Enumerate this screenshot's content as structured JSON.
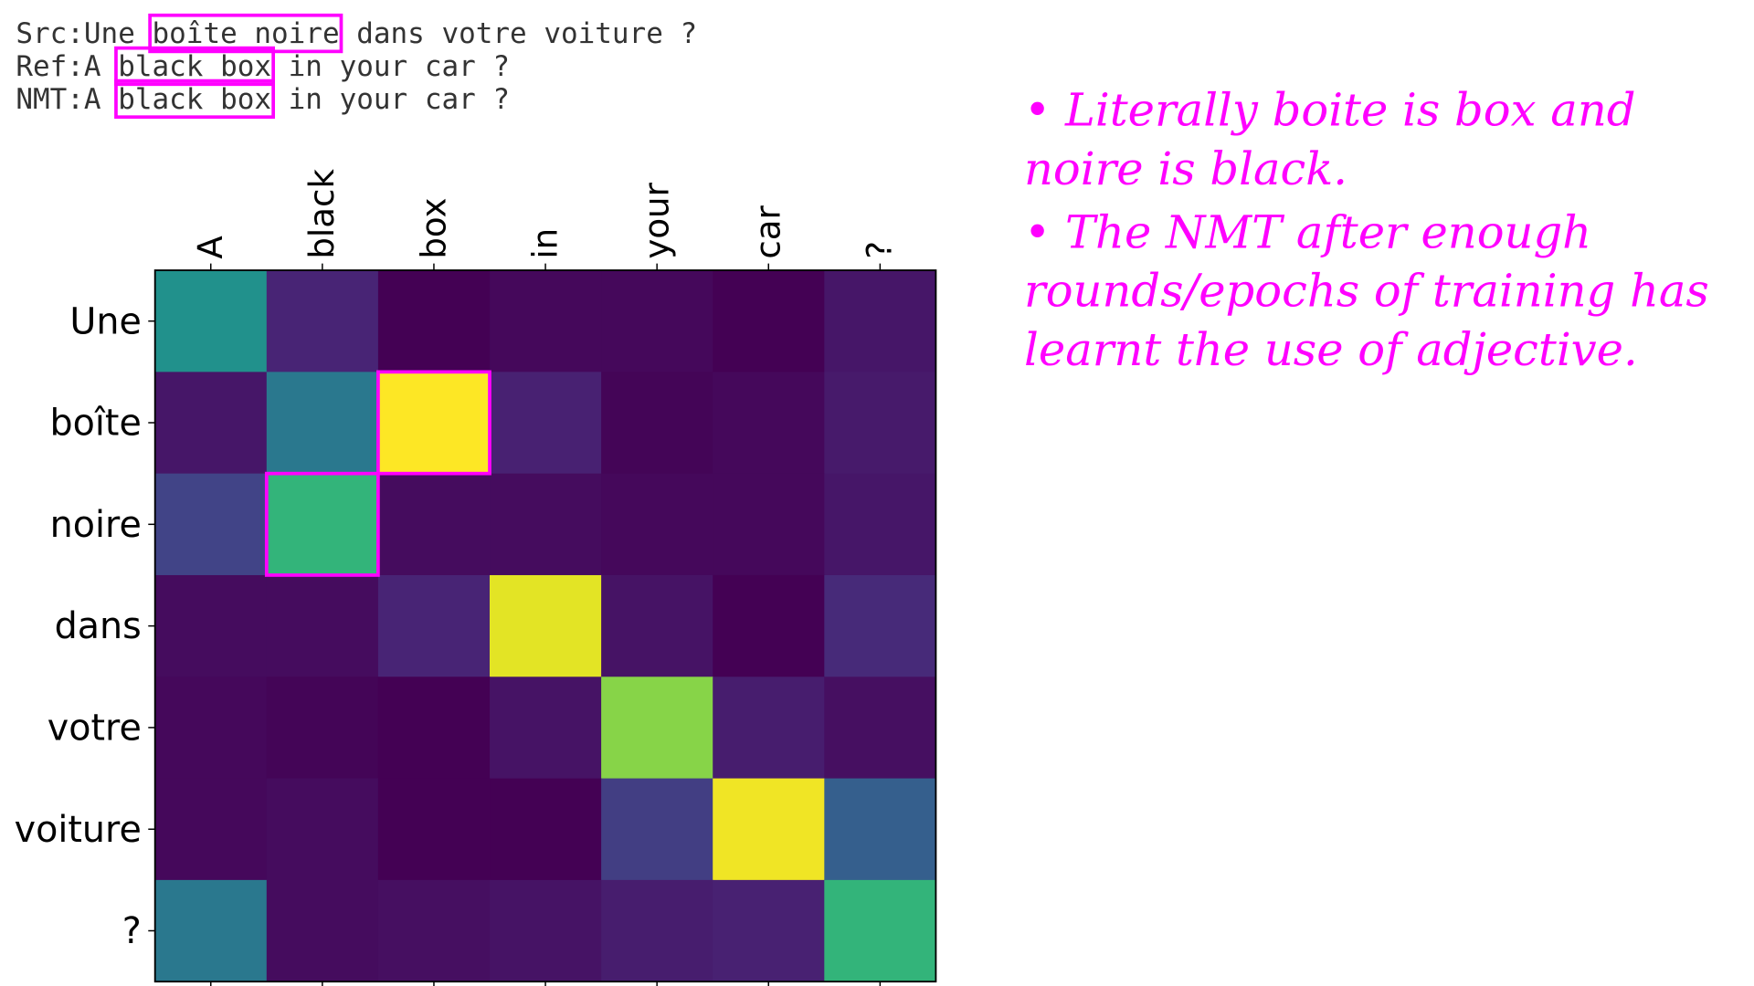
{
  "header": {
    "src_prefix": "Src:Une ",
    "src_highlight": "boîte noire",
    "src_suffix": " dans votre voiture ?",
    "ref_prefix": "Ref:A ",
    "ref_highlight": "black box",
    "ref_suffix": " in your car ?",
    "nmt_prefix": "NMT:A ",
    "nmt_highlight": "black box",
    "nmt_suffix": " in your car ?"
  },
  "notes": [
    "• Literally boite is box and noire is black.",
    "• The NMT after enough rounds/epochs of training has learnt the use of adjective."
  ],
  "colors": {
    "highlight": "#ff00ff",
    "colormap": "viridis"
  },
  "chart_data": {
    "type": "heatmap",
    "x_labels": [
      "A",
      "black",
      "box",
      "in",
      "your",
      "car",
      "?"
    ],
    "y_labels": [
      "Une",
      "boîte",
      "noire",
      "dans",
      "votre",
      "voiture",
      "?"
    ],
    "values": [
      [
        0.5,
        0.1,
        0.0,
        0.02,
        0.02,
        0.0,
        0.06
      ],
      [
        0.06,
        0.4,
        1.0,
        0.09,
        0.01,
        0.02,
        0.07
      ],
      [
        0.2,
        0.65,
        0.03,
        0.03,
        0.02,
        0.02,
        0.06
      ],
      [
        0.03,
        0.03,
        0.1,
        0.96,
        0.05,
        0.0,
        0.12
      ],
      [
        0.02,
        0.01,
        0.0,
        0.05,
        0.82,
        0.08,
        0.04
      ],
      [
        0.02,
        0.03,
        0.0,
        0.0,
        0.18,
        0.98,
        0.3
      ],
      [
        0.4,
        0.03,
        0.04,
        0.05,
        0.08,
        0.09,
        0.65
      ]
    ],
    "highlighted_cells": [
      [
        "boîte",
        "box"
      ],
      [
        "noire",
        "black"
      ]
    ],
    "colorscale_range": [
      0,
      1
    ]
  }
}
